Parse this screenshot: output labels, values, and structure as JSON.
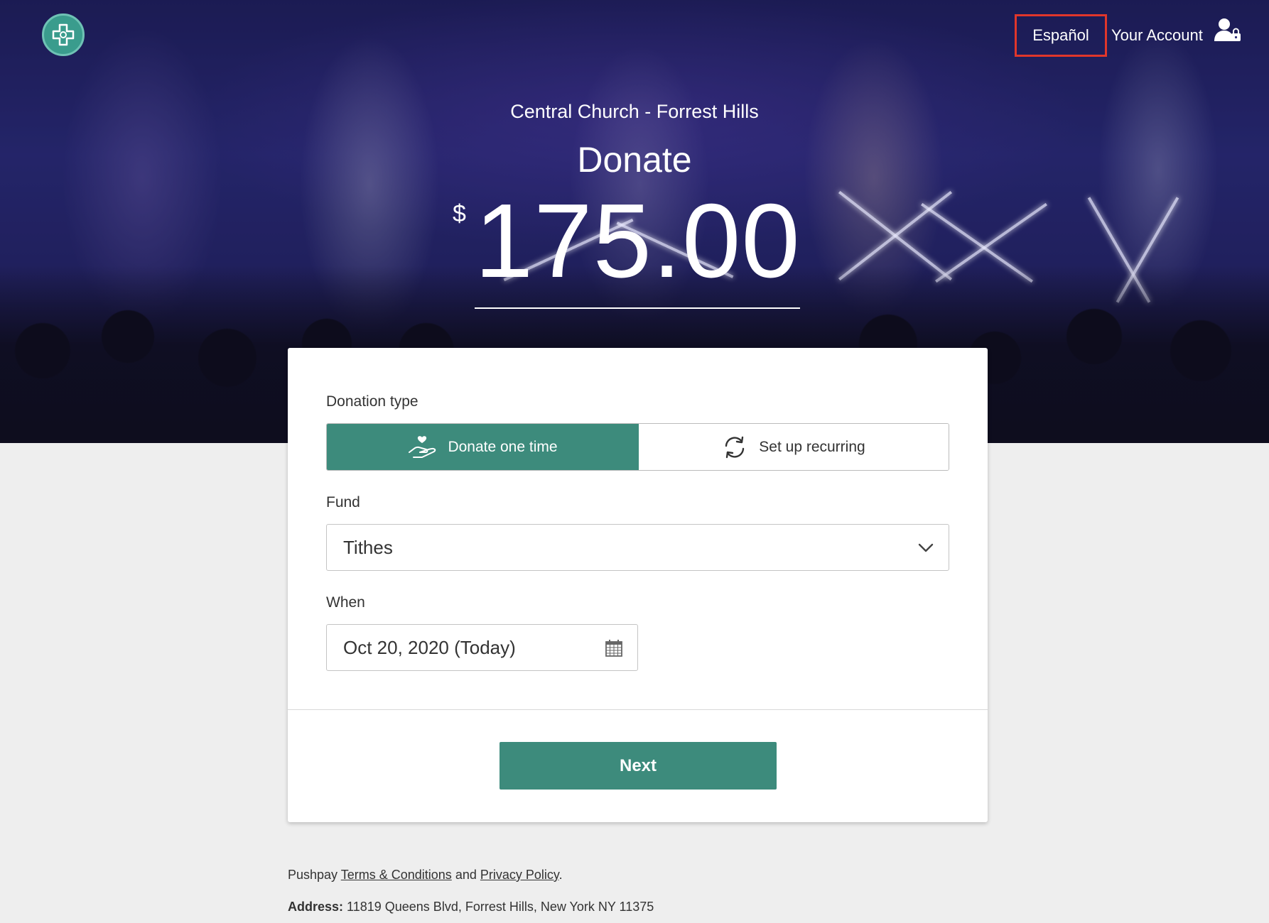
{
  "header": {
    "language_toggle": "Español",
    "account_link": "Your Account"
  },
  "hero": {
    "org_name": "Central Church - Forrest Hills",
    "title": "Donate",
    "currency_symbol": "$",
    "amount": "175.00"
  },
  "form": {
    "donation_type_label": "Donation type",
    "donation_types": [
      {
        "label": "Donate one time",
        "icon": "hand-heart-icon",
        "selected": true
      },
      {
        "label": "Set up recurring",
        "icon": "recurring-icon",
        "selected": false
      }
    ],
    "fund_label": "Fund",
    "fund_value": "Tithes",
    "when_label": "When",
    "when_value": "Oct 20, 2020 (Today)",
    "next_button": "Next"
  },
  "footer": {
    "brand": "Pushpay",
    "terms_link": "Terms & Conditions",
    "and_text": "and",
    "privacy_link": "Privacy Policy",
    "period": ".",
    "address_label": "Address:",
    "address_value": "11819 Queens Blvd, Forrest Hills, New York NY 11375"
  },
  "colors": {
    "accent": "#3d8b7c",
    "highlight_border": "#e0362b",
    "page_background": "#eeeeee"
  }
}
